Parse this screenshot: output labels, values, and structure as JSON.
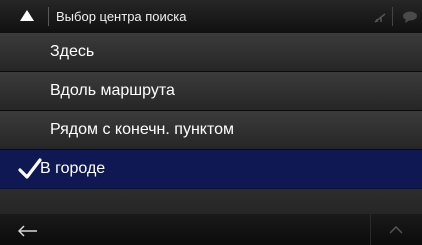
{
  "header": {
    "title": "Выбор центра поиска",
    "up_icon": "triangle-up-icon",
    "status_icons": [
      "signal-icon",
      "message-icon"
    ]
  },
  "options": [
    {
      "label": "Здесь",
      "selected": false
    },
    {
      "label": "Вдоль маршрута",
      "selected": false
    },
    {
      "label": "Рядом с конечн. пунктом",
      "selected": false
    },
    {
      "label": "В городе",
      "selected": true
    }
  ],
  "footer": {
    "back_icon": "back-arrow-icon",
    "up_icon": "chevron-up-icon"
  },
  "colors": {
    "selected_bg": "#0f1852",
    "item_bg": "#333333",
    "text": "#ffffff"
  }
}
